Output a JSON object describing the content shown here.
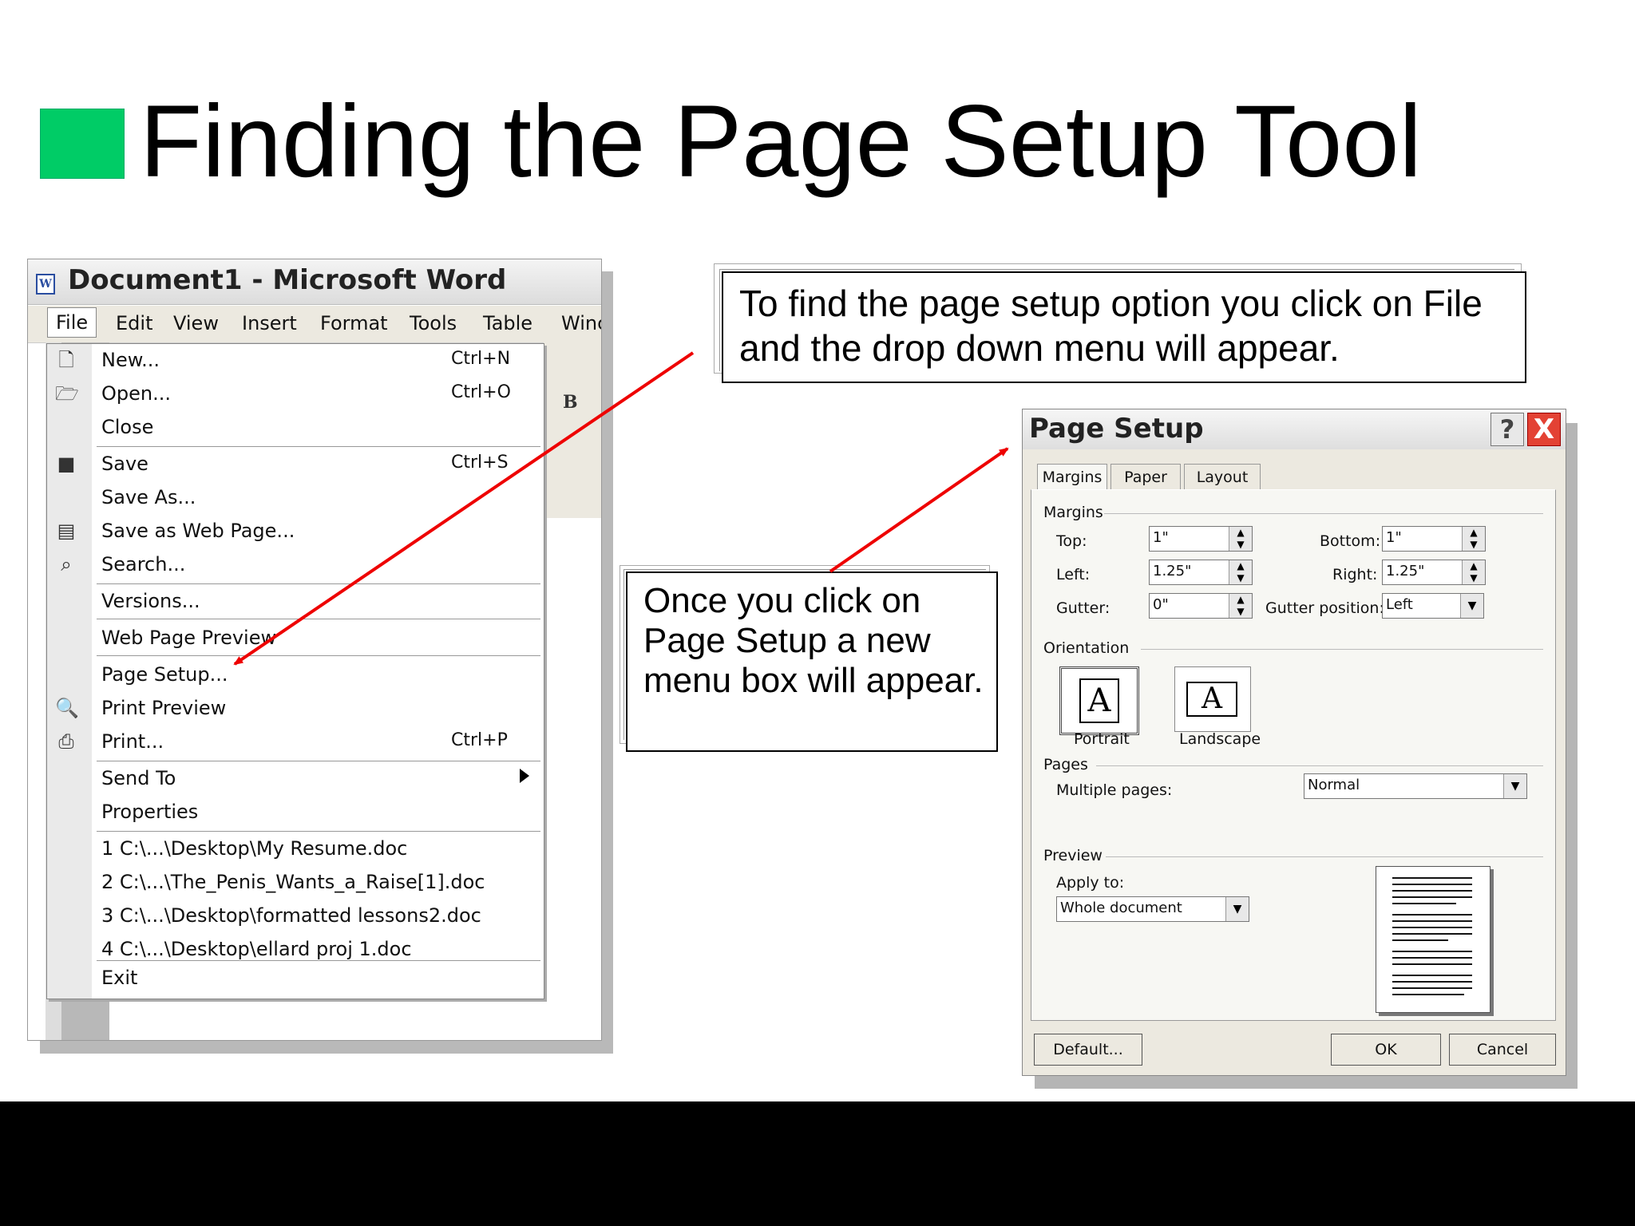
{
  "slide": {
    "title": "Finding the Page Setup Tool",
    "bullet_color": "#00cc66"
  },
  "word": {
    "window_title": "Document1 - Microsoft Word",
    "menus": [
      "File",
      "Edit",
      "View",
      "Insert",
      "Format",
      "Tools",
      "Table",
      "Winc"
    ],
    "toolbar_bold": "B"
  },
  "file_menu": {
    "items": [
      {
        "label": "New...",
        "shortcut": "Ctrl+N",
        "icon": "new-document-icon"
      },
      {
        "label": "Open...",
        "shortcut": "Ctrl+O",
        "icon": "open-folder-icon"
      },
      {
        "label": "Close",
        "shortcut": "",
        "icon": ""
      },
      {
        "label": "Save",
        "shortcut": "Ctrl+S",
        "icon": "save-disk-icon"
      },
      {
        "label": "Save As...",
        "shortcut": "",
        "icon": ""
      },
      {
        "label": "Save as Web Page...",
        "shortcut": "",
        "icon": "web-page-icon"
      },
      {
        "label": "Search...",
        "shortcut": "",
        "icon": "search-icon"
      },
      {
        "label": "Versions...",
        "shortcut": "",
        "icon": ""
      },
      {
        "label": "Web Page Preview",
        "shortcut": "",
        "icon": ""
      },
      {
        "label": "Page Setup...",
        "shortcut": "",
        "icon": ""
      },
      {
        "label": "Print Preview",
        "shortcut": "",
        "icon": "print-preview-icon"
      },
      {
        "label": "Print...",
        "shortcut": "Ctrl+P",
        "icon": "printer-icon"
      },
      {
        "label": "Send To",
        "shortcut": "",
        "icon": ""
      },
      {
        "label": "Properties",
        "shortcut": "",
        "icon": ""
      },
      {
        "label": "1 C:\\...\\Desktop\\My Resume.doc",
        "shortcut": "",
        "icon": ""
      },
      {
        "label": "2 C:\\...\\The_Penis_Wants_a_Raise[1].doc",
        "shortcut": "",
        "icon": ""
      },
      {
        "label": "3 C:\\...\\Desktop\\formatted lessons2.doc",
        "shortcut": "",
        "icon": ""
      },
      {
        "label": "4 C:\\...\\Desktop\\ellard proj 1.doc",
        "shortcut": "",
        "icon": ""
      },
      {
        "label": "Exit",
        "shortcut": "",
        "icon": ""
      }
    ]
  },
  "callouts": {
    "first": "To find the page setup option you click on File and the drop down menu will appear.",
    "second": "Once you click on Page Setup a new menu box will appear."
  },
  "dialog": {
    "title": "Page Setup",
    "help": "?",
    "close": "X",
    "tabs": [
      "Margins",
      "Paper",
      "Layout"
    ],
    "margins_group": "Margins",
    "top_label": "Top:",
    "top_value": "1\"",
    "bottom_label": "Bottom:",
    "bottom_value": "1\"",
    "left_label": "Left:",
    "left_value": "1.25\"",
    "right_label": "Right:",
    "right_value": "1.25\"",
    "gutter_label": "Gutter:",
    "gutter_value": "0\"",
    "gutter_pos_label": "Gutter position:",
    "gutter_pos_value": "Left",
    "orientation_group": "Orientation",
    "portrait": "Portrait",
    "landscape": "Landscape",
    "orient_glyph": "A",
    "pages_group": "Pages",
    "multiple_pages_label": "Multiple pages:",
    "multiple_pages_value": "Normal",
    "preview_group": "Preview",
    "apply_to_label": "Apply to:",
    "apply_to_value": "Whole document",
    "default_button": "Default...",
    "ok_button": "OK",
    "cancel_button": "Cancel"
  }
}
